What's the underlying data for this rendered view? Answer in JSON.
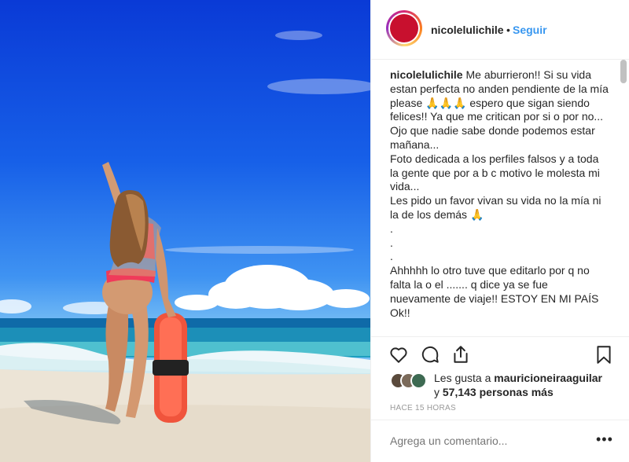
{
  "post": {
    "username": "nicolelulichile",
    "dot": "•",
    "follow_label": "Seguir",
    "caption_user": "nicolelulichile",
    "caption_text": " Me aburrieron!! Si su vida estan perfecta no anden pendiente de la mía please 🙏🙏🙏 espero que sigan siendo felices!! Ya que me critican por si o por no...\nOjo que nadie sabe donde podemos estar mañana...\nFoto dedicada a los perfiles falsos y a toda la gente que por a b c motivo le molesta mi vida...\nLes pido un favor vivan su vida no la mía ni la de los demás 🙏\n.\n.\n.\nAhhhhh lo otro tuve que editarlo por q no falta la o el ....... q dice ya se fue nuevamente de viaje!! ESTOY EN MI PAÍS Ok!!",
    "likes_prefix": "Les gusta a",
    "likes_user": "mauricioneiraaguilar",
    "likes_and": "y",
    "likes_count": "57,143 personas más",
    "timestamp": "HACE 15 HORAS",
    "comment_placeholder": "Agrega un comentario...",
    "more_label": "•••"
  },
  "icons": {
    "like": "heart-icon",
    "comment": "comment-icon",
    "share": "share-icon",
    "save": "bookmark-icon"
  },
  "colors": {
    "link": "#3897f0",
    "text": "#262626",
    "muted": "#999999",
    "ring": "#d62976"
  }
}
